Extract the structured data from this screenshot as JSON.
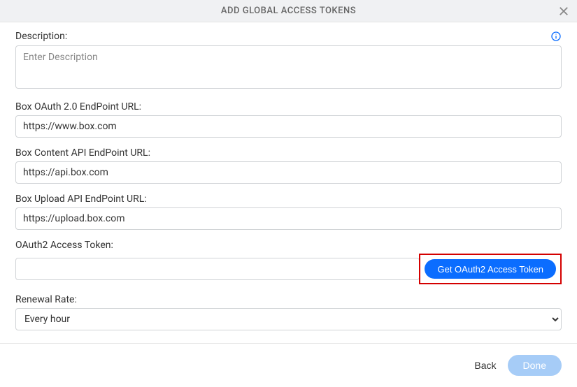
{
  "header": {
    "title": "ADD GLOBAL ACCESS TOKENS"
  },
  "fields": {
    "description": {
      "label": "Description:",
      "placeholder": "Enter Description",
      "value": ""
    },
    "oauth_url": {
      "label": "Box OAuth 2.0 EndPoint URL:",
      "value": "https://www.box.com"
    },
    "content_api_url": {
      "label": "Box Content API EndPoint URL:",
      "value": "https://api.box.com"
    },
    "upload_api_url": {
      "label": "Box Upload API EndPoint URL:",
      "value": "https://upload.box.com"
    },
    "access_token": {
      "label": "OAuth2 Access Token:",
      "value": "",
      "button": "Get OAuth2 Access Token"
    },
    "renewal_rate": {
      "label": "Renewal Rate:",
      "value": "Every hour"
    }
  },
  "footer": {
    "back": "Back",
    "done": "Done"
  }
}
